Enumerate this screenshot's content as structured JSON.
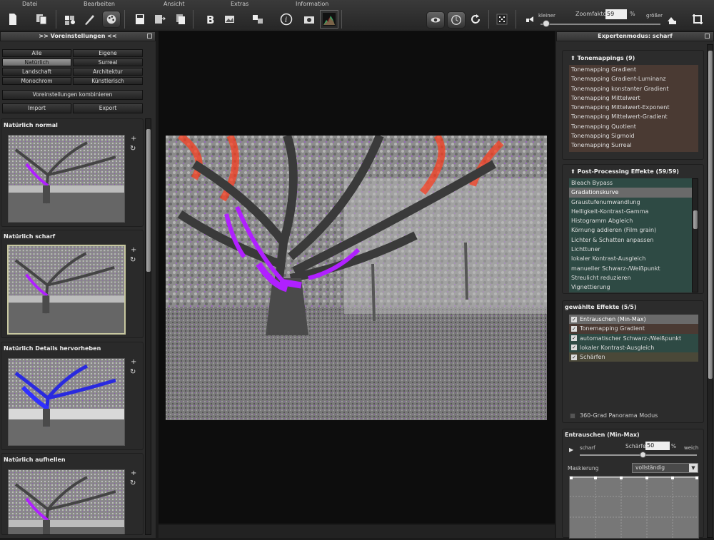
{
  "menu": {
    "datei": "Datei",
    "bearbeiten": "Bearbeiten",
    "ansicht": "Ansicht",
    "extras": "Extras",
    "information": "Information"
  },
  "zoom": {
    "kleiner": "kleiner",
    "label": "Zoomfaktor",
    "value": "59",
    "unit": "%",
    "groesser": "größer"
  },
  "left_panel": {
    "title": ">> Voreinstellungen <<",
    "categories": [
      "Alle",
      "Eigene",
      "Natürlich",
      "Surreal",
      "Landschaft",
      "Architektur",
      "Monochrom",
      "Künstlerisch"
    ],
    "combine": "Voreinstellungen kombinieren",
    "import": "Import",
    "export": "Export",
    "presets": [
      "Natürlich normal",
      "Natürlich scharf",
      "Natürlich Details hervorheben",
      "Natürlich aufhellen"
    ],
    "add_symbol": "+",
    "reset_symbol": "↻"
  },
  "right_panel": {
    "title": "Expertenmodus: scharf",
    "tonemappings_title": "Tonemappings (9)",
    "tonemappings": [
      "Tonemapping Gradient",
      "Tonemapping Gradient-Luminanz",
      "Tonemapping konstanter Gradient",
      "Tonemapping Mittelwert",
      "Tonemapping Mittelwert-Exponent",
      "Tonemapping Mittelwert-Gradient",
      "Tonemapping Quotient",
      "Tonemapping Sigmoid",
      "Tonemapping Surreal"
    ],
    "postproc_title": "Post-Processing Effekte (59/59)",
    "postproc": [
      "Bleach Bypass",
      "Gradationskurve",
      "Graustufenumwandlung",
      "Helligkeit-Kontrast-Gamma",
      "Histogramm Abgleich",
      "Körnung addieren (Film grain)",
      "Lichter & Schatten anpassen",
      "Lichttuner",
      "lokaler Kontrast-Ausgleich",
      "manueller Schwarz-/Weißpunkt",
      "Streulicht reduzieren",
      "Vignettierung"
    ],
    "selected_title": "gewählte Effekte (5/5)",
    "selected": [
      "Entrauschen (Min-Max)",
      "Tonemapping Gradient",
      "automatischer Schwarz-/Weißpunkt",
      "lokaler Kontrast-Ausgleich",
      "Schärfen"
    ],
    "panorama": "360-Grad Panorama Modus",
    "effect_title": "Entrauschen (Min-Max)",
    "scharf": "scharf",
    "schaerfe_label": "Schärfe",
    "schaerfe_value": "50",
    "percent": "%",
    "weich": "weich",
    "schaerfe_level": 0.5,
    "maskierung": "Maskierung",
    "maskierung_value": "vollständig"
  },
  "colors": {
    "tonemap_bg": "#4a3a33",
    "postproc_bg": "#2e4a44",
    "selected_highlight": "#6a6a6a",
    "accent_purple": "#b020ff"
  }
}
